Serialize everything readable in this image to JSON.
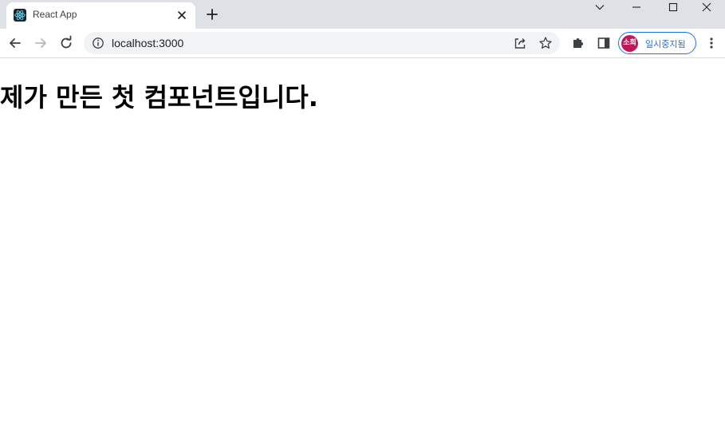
{
  "browser": {
    "tab": {
      "title": "React App",
      "favicon": "react-logo-icon"
    },
    "address_bar": {
      "url": "localhost:3000",
      "security_icon": "info-icon"
    },
    "profile": {
      "avatar_text": "소희",
      "status_label": "일시중지됨",
      "avatar_color": "#c2185b",
      "accent_color": "#1a73e8"
    },
    "icons": {
      "back": "arrow-left-icon",
      "forward": "arrow-right-icon",
      "reload": "reload-icon",
      "share": "share-icon",
      "bookmark": "star-icon",
      "extensions": "puzzle-icon",
      "side_panel": "side-panel-icon",
      "menu": "kebab-menu-icon",
      "new_tab": "plus-icon",
      "tab_close": "close-icon",
      "tab_search": "chevron-down-icon",
      "minimize": "minimize-icon",
      "maximize": "maximize-icon",
      "close_window": "close-icon"
    }
  },
  "page": {
    "heading": "제가 만든 첫 컴포넌트입니다."
  }
}
